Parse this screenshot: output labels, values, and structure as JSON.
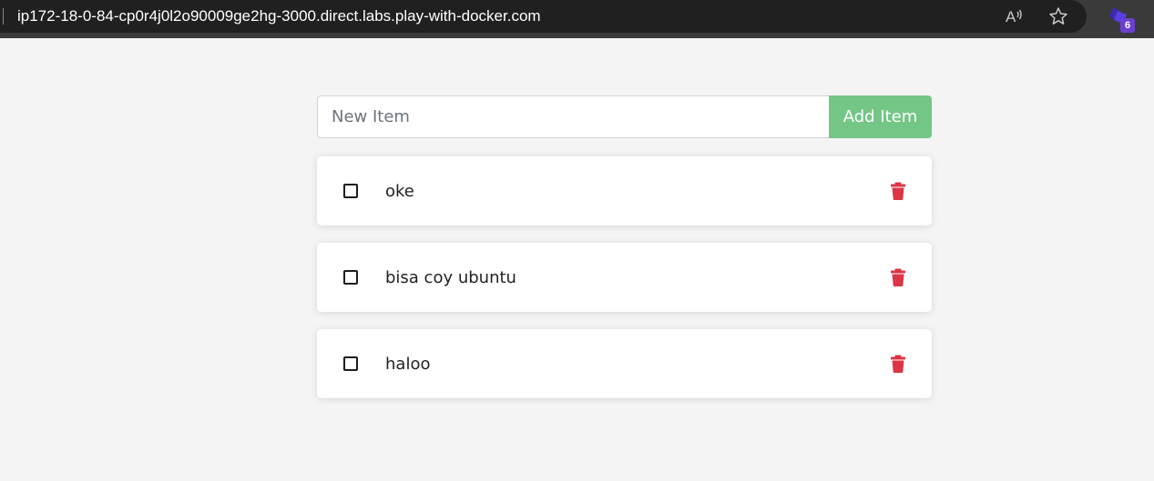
{
  "browser": {
    "url": "ip172-18-0-84-cp0r4j0l2o90009ge2hg-3000.direct.labs.play-with-docker.com",
    "icons": {
      "read_aloud": "read-aloud-icon",
      "favorite": "star-icon",
      "extension": "extension-icon"
    },
    "extension_badge": "6",
    "colors": {
      "badge": "#6b3fd1"
    }
  },
  "form": {
    "input_value": "",
    "input_placeholder": "New Item",
    "add_button_label": "Add Item"
  },
  "todos": [
    {
      "name": "oke",
      "completed": false
    },
    {
      "name": "bisa coy ubuntu",
      "completed": false
    },
    {
      "name": "haloo",
      "completed": false
    }
  ],
  "colors": {
    "accent_green": "#74c686",
    "delete_red": "#dc3545",
    "background": "#f4f4f4"
  }
}
